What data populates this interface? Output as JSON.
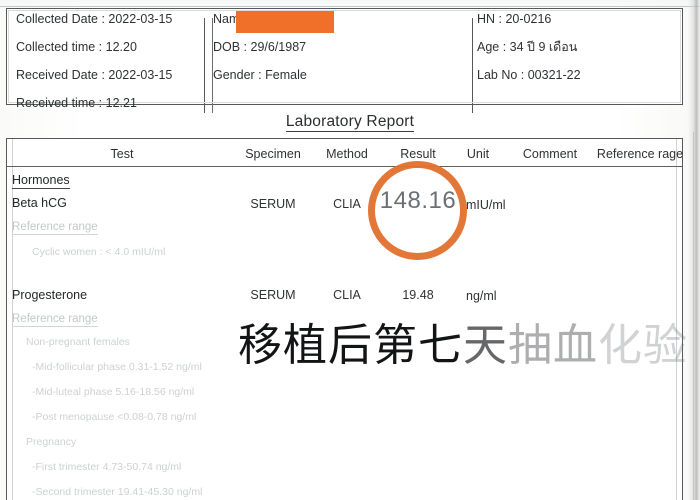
{
  "document": {
    "title": "Laboratory Report"
  },
  "patient_header": {
    "left_column": [
      "Collected Date : 2022-03-15",
      "Collected time : 12.20",
      "Received Date : 2022-03-15",
      "Received time : 12.21"
    ],
    "middle_column": [
      "Name :",
      "DOB : 29/6/1987",
      "Gender : Female"
    ],
    "right_column": [
      "HN : 20-0216",
      "Age : 34 ปี 9 เดือน",
      "Lab No : 00321-22"
    ],
    "redaction": {
      "name": "name-redaction-bar",
      "color": "#F0702A"
    }
  },
  "table": {
    "columns": [
      "Test",
      "Specimen",
      "Method",
      "Result",
      "Unit",
      "Comment",
      "Reference rage"
    ],
    "group_label": "Hormones",
    "rows": [
      {
        "test": "Beta hCG",
        "specimen": "SERUM",
        "method": "CLIA",
        "result": "148.16",
        "unit": "mIU/ml",
        "comment": "",
        "reference_rage": "",
        "reference_heading": "Reference range",
        "reference_items": [
          "Cyclic women : < 4.0 mIU/ml"
        ]
      },
      {
        "test": "Progesterone",
        "specimen": "SERUM",
        "method": "CLIA",
        "result": "19.48",
        "unit": "ng/ml",
        "comment": "",
        "reference_rage": "",
        "reference_heading": "Reference range",
        "reference_items": [
          "Non-pregnant females",
          "-Mid-follicular phase 0.31-1.52 ng/ml",
          "-Mid-luteal phase 5.16-18.56 ng/ml",
          "-Post menopause <0.08-0.78 ng/ml",
          "Pregnancy",
          "-First trimester 4.73-50.74 ng/ml",
          "-Second trimester 19.41-45.30 ng/ml"
        ]
      }
    ]
  },
  "annotations": {
    "circle": {
      "target": "148.16",
      "color": "#E2702C"
    },
    "caption": {
      "full_text": "移植后第七天抽血化验",
      "clear_part": "移植后第七",
      "fading_part_1": "天",
      "fading_part_2": "抽血",
      "fading_part_3": "化验"
    }
  }
}
